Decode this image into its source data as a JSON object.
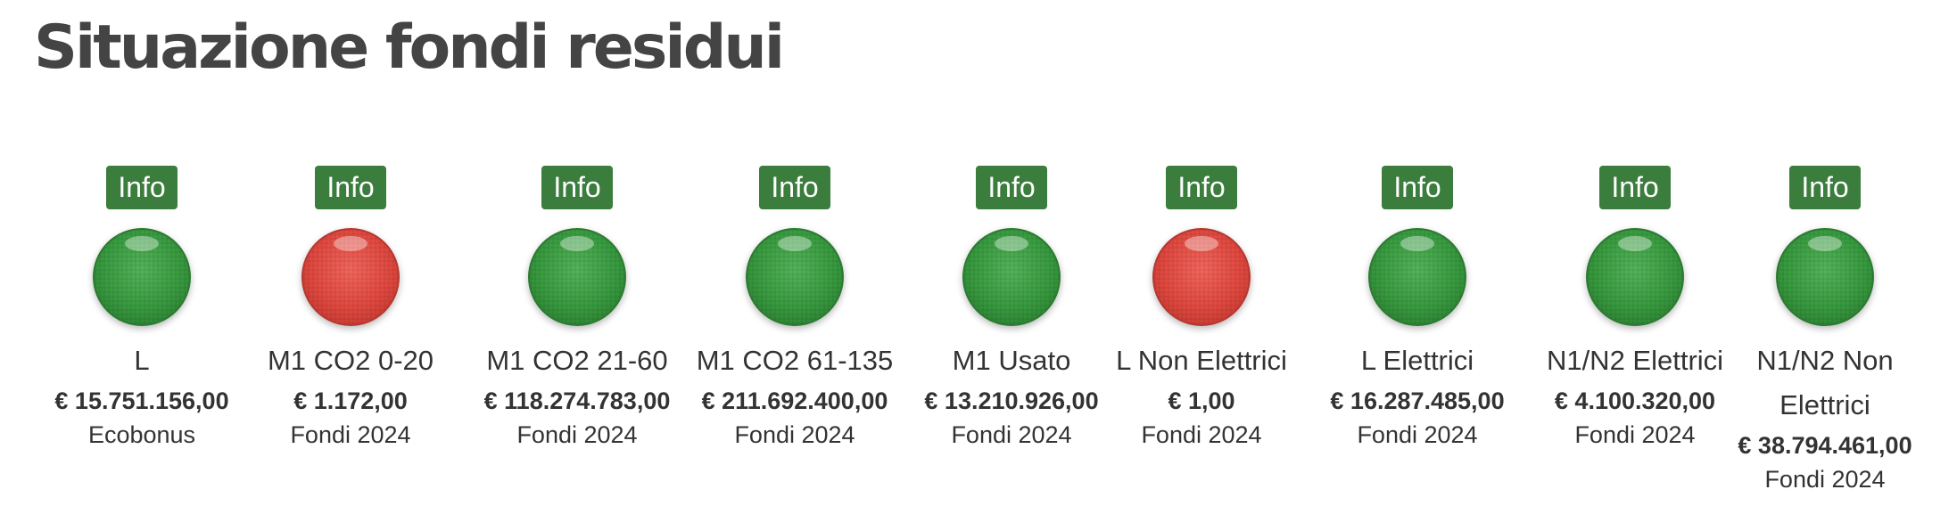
{
  "page": {
    "title": "Situazione fondi residui"
  },
  "funds": [
    {
      "info_label": "Info",
      "status": "green",
      "name": "L",
      "amount": "€ 15.751.156,00",
      "source": "Ecobonus"
    },
    {
      "info_label": "Info",
      "status": "red",
      "name": "M1 CO2 0-20",
      "amount": "€ 1.172,00",
      "source": "Fondi 2024"
    },
    {
      "info_label": "Info",
      "status": "green",
      "name": "M1 CO2 21-60",
      "amount": "€ 118.274.783,00",
      "source": "Fondi 2024"
    },
    {
      "info_label": "Info",
      "status": "green",
      "name": "M1 CO2 61-135",
      "amount": "€ 211.692.400,00",
      "source": "Fondi 2024"
    },
    {
      "info_label": "Info",
      "status": "green",
      "name": "M1 Usato",
      "amount": "€ 13.210.926,00",
      "source": "Fondi 2024"
    },
    {
      "info_label": "Info",
      "status": "red",
      "name": "L Non Elettrici",
      "amount": "€ 1,00",
      "source": "Fondi 2024"
    },
    {
      "info_label": "Info",
      "status": "green",
      "name": "L Elettrici",
      "amount": "€ 16.287.485,00",
      "source": "Fondi 2024"
    },
    {
      "info_label": "Info",
      "status": "green",
      "name": "N1/N2 Elettrici",
      "amount": "€ 4.100.320,00",
      "source": "Fondi 2024"
    },
    {
      "info_label": "Info",
      "status": "green",
      "name": "N1/N2 Non Elettrici",
      "amount": "€ 38.794.461,00",
      "source": "Fondi 2024"
    }
  ],
  "colors": {
    "info_button": "#3a7d3c",
    "status_green": "#389a3f",
    "status_red": "#e0483f",
    "title_text": "#444444"
  }
}
